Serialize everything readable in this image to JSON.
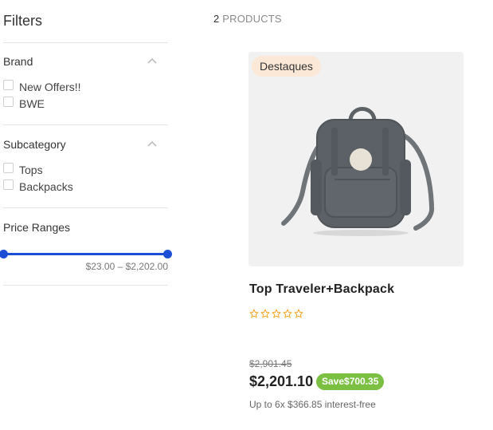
{
  "sidebar": {
    "title": "Filters",
    "brand": {
      "title": "Brand",
      "options": [
        {
          "label": "New Offers!!",
          "checked": false
        },
        {
          "label": "BWE",
          "checked": false
        }
      ]
    },
    "subcategory": {
      "title": "Subcategory",
      "options": [
        {
          "label": "Tops",
          "checked": false
        },
        {
          "label": "Backpacks",
          "checked": false
        }
      ]
    },
    "price": {
      "title": "Price Ranges",
      "range_label": "$23.00 – $2,202.00",
      "min": 23.0,
      "max": 2202.0
    }
  },
  "results": {
    "count": "2",
    "count_label": "PRODUCTS"
  },
  "product": {
    "badge": "Destaques",
    "name": "Top Traveler+Backpack",
    "rating": 0,
    "old_price": "$2,901.45",
    "price": "$2,201.10",
    "save_label": "Save$700.35",
    "installments": "Up to 6x $366.85 interest-free"
  },
  "colors": {
    "accent": "#1c4fd6",
    "save_badge": "#7bc043",
    "highlight_badge": "#fbe8d7",
    "star": "#f5a623"
  },
  "icons": {
    "section_toggle": "chevron-up-icon",
    "rating": "star-outline-icon"
  }
}
